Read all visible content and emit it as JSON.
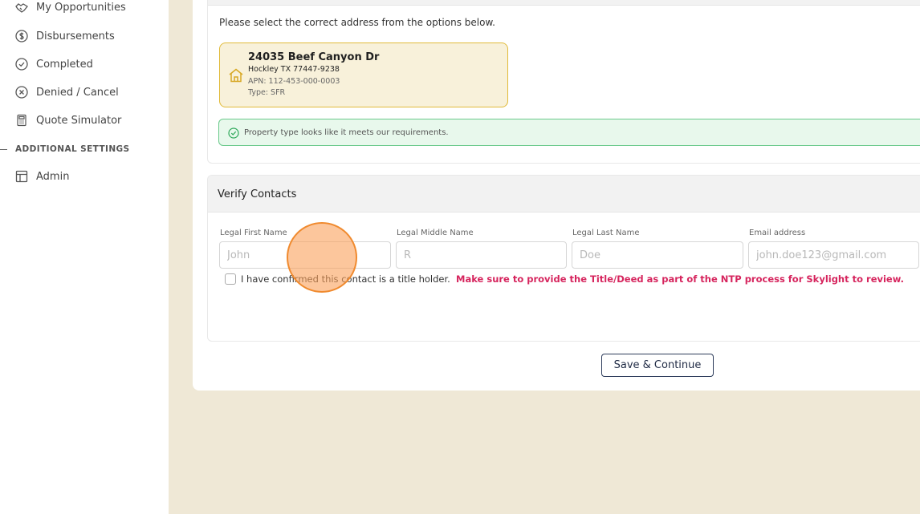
{
  "sidebar": {
    "items": [
      {
        "label": "My Opportunities",
        "icon": "handshake-icon"
      },
      {
        "label": "Disbursements",
        "icon": "dollar-circle-icon"
      },
      {
        "label": "Completed",
        "icon": "check-circle-icon"
      },
      {
        "label": "Denied / Cancel",
        "icon": "x-circle-icon"
      },
      {
        "label": "Quote Simulator",
        "icon": "calculator-icon"
      }
    ],
    "section_header": "ADDITIONAL SETTINGS",
    "admin": {
      "label": "Admin",
      "icon": "layout-icon"
    }
  },
  "address": {
    "instruction": "Please select the correct address from the options below.",
    "card": {
      "street": "24035 Beef Canyon Dr",
      "city": "Hockley TX 77447-9238",
      "apn": "APN: 112-453-000-0003",
      "type": "Type: SFR"
    },
    "success_message": "Property type looks like it meets our requirements."
  },
  "contacts": {
    "title": "Verify Contacts",
    "fields": [
      {
        "label": "Legal First Name",
        "placeholder": "John"
      },
      {
        "label": "Legal Middle Name",
        "placeholder": "R"
      },
      {
        "label": "Legal Last Name",
        "placeholder": "Doe"
      },
      {
        "label": "Email address",
        "placeholder": "john.doe123@gmail.com"
      }
    ],
    "confirm_label": "I have confirmed this contact is a title holder.",
    "warning": "Make sure to provide the Title/Deed as part of the NTP process for Skylight to review."
  },
  "actions": {
    "save_label": "Save & Continue"
  },
  "colors": {
    "background": "#efe8d6",
    "accent_yellow": "#e1bb3a",
    "success_green": "#69c98a",
    "warning_pink": "#d6245d",
    "click_orange": "#f08a2e"
  }
}
